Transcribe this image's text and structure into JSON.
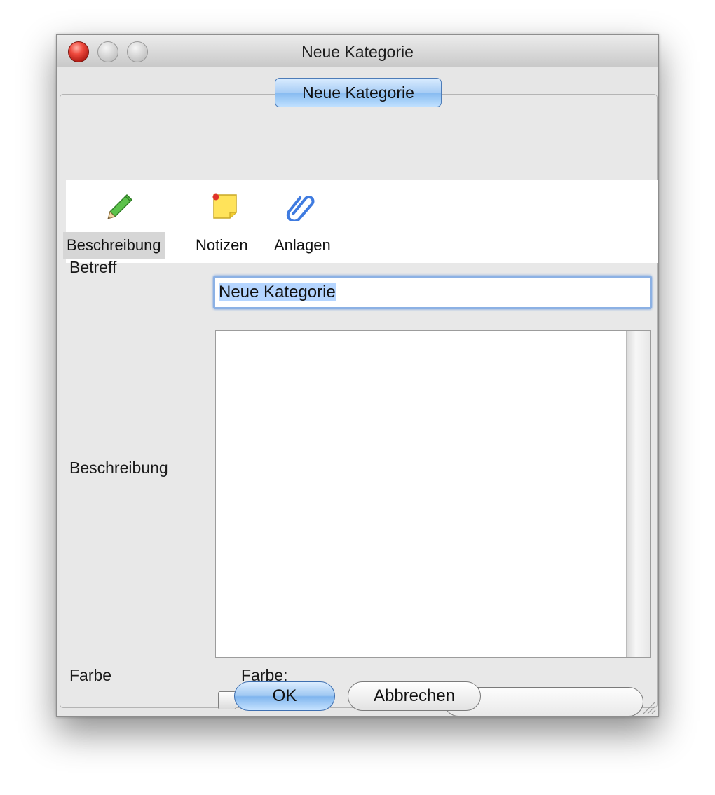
{
  "window": {
    "title": "Neue Kategorie"
  },
  "tab": {
    "label": "Neue Kategorie"
  },
  "toolbar": {
    "items": [
      {
        "label": "Beschreibung",
        "icon": "pencil-icon",
        "selected": true
      },
      {
        "label": "Notizen",
        "icon": "sticky-note-icon",
        "selected": false
      },
      {
        "label": "Anlagen",
        "icon": "paperclip-icon",
        "selected": false
      }
    ]
  },
  "form": {
    "subject_label": "Betreff",
    "subject_value": "Neue Kategorie",
    "description_label": "Beschreibung",
    "description_value": "",
    "color_label": "Farbe",
    "color_checkbox_label": "Farbe:",
    "color_checkbox_checked": false
  },
  "buttons": {
    "ok": "OK",
    "cancel": "Abbrechen"
  },
  "colors": {
    "accent": "#8cb1e4",
    "selection": "#b5d5ff",
    "window_bg": "#e6e6e6",
    "close_button": "#ef4a3e"
  }
}
